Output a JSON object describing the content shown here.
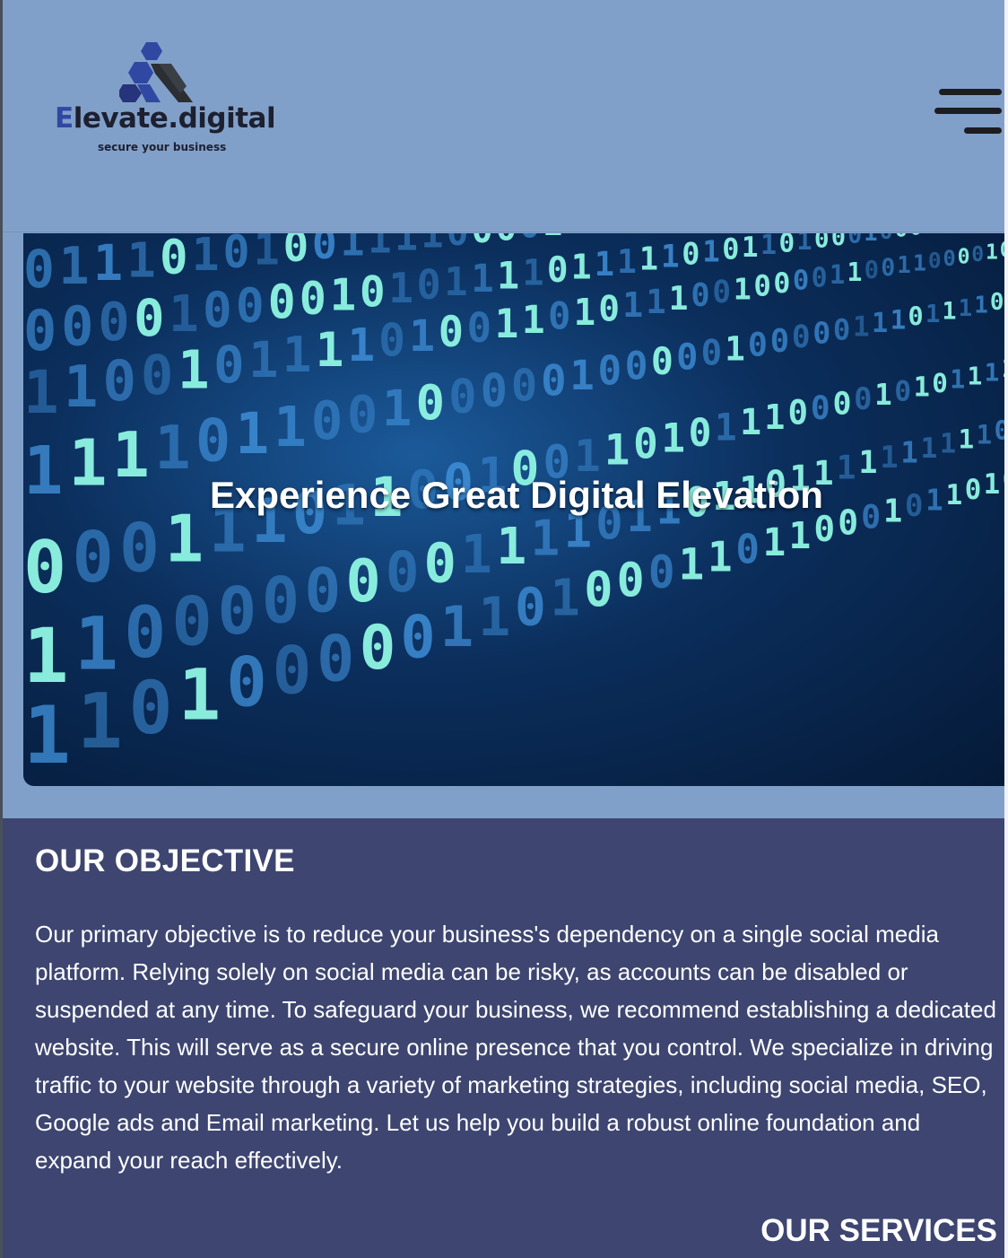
{
  "header": {
    "logo_text_first": "E",
    "logo_text_rest": "levate.digital",
    "logo_tagline": "secure your business",
    "menu_icon": "hamburger-menu-icon"
  },
  "hero": {
    "title": "Experience Great Digital Elevation",
    "background_image": "binary-code-matrix"
  },
  "objective": {
    "title": "OUR OBJECTIVE",
    "text": "Our primary objective is to reduce your business's dependency on a single social media platform. Relying solely on social media can be risky, as accounts can be disabled or suspended at any time. To safeguard your business, we recommend establishing a dedicated website. This will serve as a secure online presence that you control. We specialize in driving traffic to your website through a variety of marketing strategies, including social media, SEO, Google ads and Email marketing. Let us help you build a robust online foundation and expand your reach effectively."
  },
  "services": {
    "title": "OUR SERVICES"
  },
  "colors": {
    "header_bg": "#81a0c9",
    "section_bg": "#3d4570",
    "logo_accent": "#3148a3",
    "hero_glow": "#7fffe4"
  }
}
